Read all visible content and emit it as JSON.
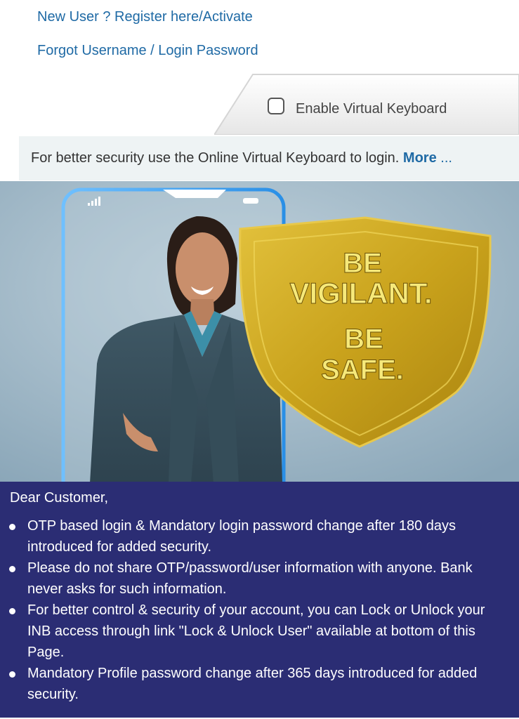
{
  "links": {
    "register": "New User ? Register here/Activate",
    "forgot": "Forgot Username / Login Password"
  },
  "virtual_keyboard": {
    "label": "Enable Virtual Keyboard",
    "checked": false
  },
  "security_bar": {
    "text": "For better security use the Online Virtual Keyboard to login.",
    "more": "More",
    "more_suffix": " ..."
  },
  "banner": {
    "line1": "BE",
    "line2": "VIGILANT.",
    "line3": "BE",
    "line4": "SAFE."
  },
  "notice": {
    "greeting": "Dear Customer,",
    "items": [
      "OTP based login & Mandatory login password change after 180 days introduced for added security.",
      "Please do not share OTP/password/user information with anyone. Bank never asks for such information.",
      "For better control & security of your account, you can Lock or Unlock your INB access through link \"Lock & Unlock User\" available at bottom of this Page.",
      "Mandatory Profile password change after 365 days introduced for added security."
    ]
  },
  "colors": {
    "link": "#1f6aa5",
    "notice_bg": "#2b2d74",
    "shield_gold": "#c9a21c",
    "shield_text": "#f6e97a"
  }
}
